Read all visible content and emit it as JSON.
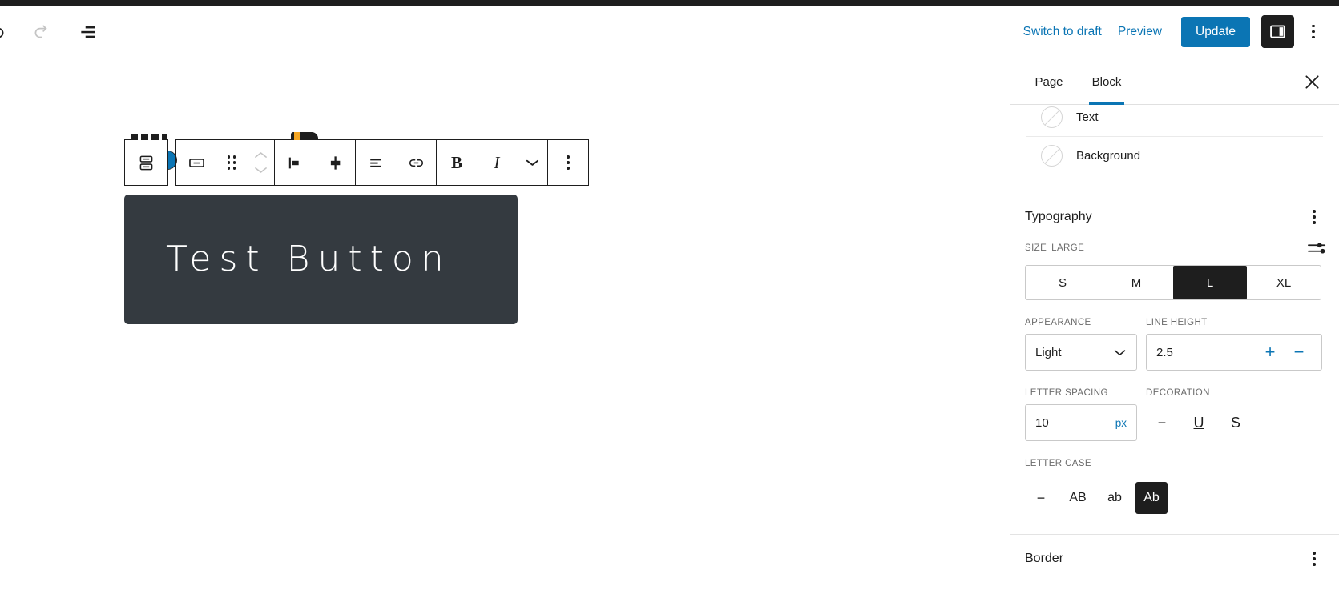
{
  "header": {
    "undo_label": "Undo",
    "redo_label": "Redo",
    "list_view_label": "Document Overview",
    "switch_to_draft_label": "Switch to draft",
    "preview_label": "Preview",
    "update_label": "Update",
    "sidebar_toggle_label": "Settings",
    "options_label": "Options",
    "accent_color": "#0b75b4"
  },
  "block_toolbar": {
    "parent_block_label": "Select Buttons",
    "change_block_type_label": "Button",
    "drag_label": "Drag",
    "move_up_label": "Move up",
    "move_down_label": "Move down",
    "align_left_label": "Align text left",
    "align_center_label": "Align text center",
    "justify_label": "Change alignment",
    "link_label": "Link",
    "bold_label": "B",
    "italic_label": "I",
    "more_formats_label": "More",
    "options_label": "Options"
  },
  "canvas": {
    "button_text": "Test Button",
    "button_background": "#343a40",
    "button_text_color": "#ffffff"
  },
  "sidebar": {
    "tabs": [
      {
        "label": "Page",
        "active": false
      },
      {
        "label": "Block",
        "active": true
      }
    ],
    "close_label": "Close settings",
    "color_rows": [
      {
        "label": "Text"
      },
      {
        "label": "Background"
      }
    ],
    "typography": {
      "title": "Typography",
      "options_label": "Typography options",
      "size": {
        "label": "SIZE",
        "value_label": "LARGE",
        "custom_toggle_label": "Set custom size",
        "options": [
          "S",
          "M",
          "L",
          "XL"
        ],
        "selected": "L"
      },
      "appearance": {
        "label": "APPEARANCE",
        "value": "Light"
      },
      "line_height": {
        "label": "LINE HEIGHT",
        "value": "2.5",
        "increment_label": "+",
        "decrement_label": "−"
      },
      "letter_spacing": {
        "label": "LETTER SPACING",
        "value": "10",
        "unit": "px"
      },
      "decoration": {
        "label": "DECORATION",
        "options": [
          "none",
          "underline",
          "strikethrough"
        ],
        "glyphs": [
          "−",
          "U",
          "S"
        ],
        "selected": "none_unselected"
      },
      "letter_case": {
        "label": "LETTER CASE",
        "options": [
          "none",
          "uppercase",
          "lowercase",
          "capitalize"
        ],
        "glyphs": [
          "−",
          "AB",
          "ab",
          "Ab"
        ],
        "selected": "capitalize"
      }
    },
    "border": {
      "title": "Border",
      "options_label": "Border options"
    }
  }
}
